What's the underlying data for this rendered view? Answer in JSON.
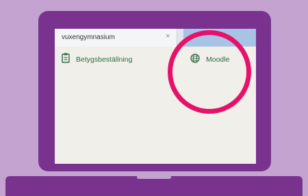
{
  "browser": {
    "tab": {
      "title": "vuxengymnasium",
      "close_label": "×"
    },
    "favorites": [
      {
        "label": "Betygsbeställning",
        "icon": "clipboard-icon"
      },
      {
        "label": "Moodle",
        "icon": "globe-icon"
      }
    ]
  },
  "colors": {
    "background": "#c4a3d1",
    "laptop": "#79338f",
    "highlight": "#e6126a",
    "favorite_text": "#2a6a45"
  }
}
